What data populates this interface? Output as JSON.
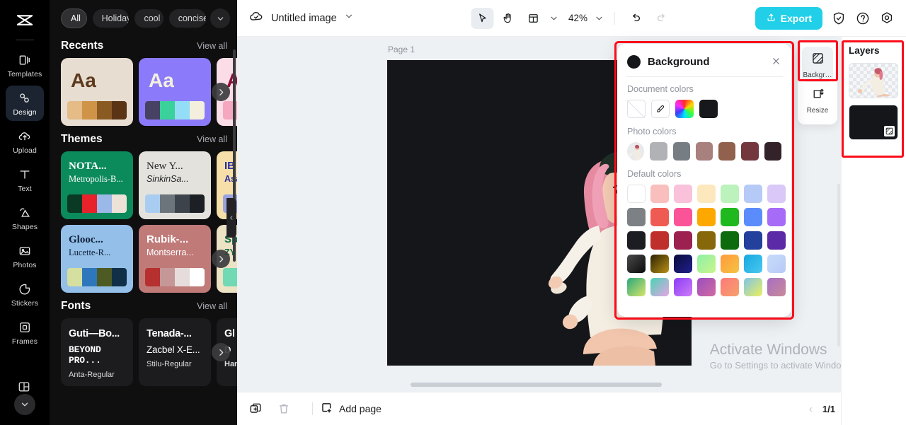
{
  "app": {
    "name": "CapCut",
    "logo_icon": "capcut-logo-icon"
  },
  "rail": {
    "items": [
      {
        "label": "Templates",
        "icon": "templates-icon",
        "active": false
      },
      {
        "label": "Design",
        "icon": "design-icon",
        "active": true
      },
      {
        "label": "Upload",
        "icon": "upload-cloud-icon",
        "active": false
      },
      {
        "label": "Text",
        "icon": "text-icon",
        "active": false
      },
      {
        "label": "Shapes",
        "icon": "shapes-icon",
        "active": false
      },
      {
        "label": "Photos",
        "icon": "photos-icon",
        "active": false
      },
      {
        "label": "Stickers",
        "icon": "stickers-icon",
        "active": false
      },
      {
        "label": "Frames",
        "icon": "frames-icon",
        "active": false
      }
    ],
    "more_icon": "chevron-down-icon",
    "partial_icon": "grid-layout-icon"
  },
  "panel": {
    "chips": [
      {
        "label": "All",
        "active": true
      },
      {
        "label": "Holiday",
        "active": false
      },
      {
        "label": "cool",
        "active": false
      },
      {
        "label": "concise",
        "active": false
      }
    ],
    "chips_more_icon": "chevron-down-icon",
    "sections": [
      {
        "title": "Recents",
        "view_all": "View all",
        "cards": [
          {
            "sample": "Aa",
            "bg": "#e7ddd0",
            "fg": "#5c3a1e",
            "palette": [
              "#e5bb86",
              "#cf9447",
              "#8a5a23",
              "#5a3414"
            ]
          },
          {
            "sample": "Aa",
            "bg": "#8b7bfa",
            "fg": "#f4f0de",
            "palette": [
              "#474264",
              "#3ad19b",
              "#93ddf7",
              "#f3efdc"
            ]
          },
          {
            "sample": "A",
            "bg": "#fadde6",
            "fg": "#8e0e3a",
            "palette": [
              "#f4a7bf",
              "#f7c9d8",
              "#ffffff",
              "#e8718f"
            ]
          }
        ]
      },
      {
        "title": "Themes",
        "view_all": "View all",
        "cards": [
          {
            "title": "NOTA...",
            "subtitle": "Metropolis-B...",
            "bg": "#0b8a5c",
            "fg": "#ffffff",
            "palette": [
              "#0b3a24",
              "#e8222a",
              "#9ab8e8",
              "#ece2d8"
            ]
          },
          {
            "title": "New Y...",
            "subtitle": "SinkinSa...",
            "bg": "#e4e2dc",
            "fg": "#22252a",
            "palette": [
              "#a9cdf0",
              "#6c747c",
              "#3d434b",
              "#1c1f24"
            ]
          },
          {
            "title": "IB",
            "subtitle": "Asa",
            "bg": "#f6dfa8",
            "fg": "#2b2fa0",
            "palette": [
              "#9aa2e0",
              "#c9cdee",
              "#ffffff",
              "#4049b8"
            ]
          },
          {
            "title": "Glooc...",
            "subtitle": "Lucette-R...",
            "bg": "#93bfe8",
            "fg": "#12213a",
            "palette": [
              "#d5dfa0",
              "#2f77bd",
              "#4d5a23",
              "#113048"
            ]
          },
          {
            "title": "Rubik-...",
            "subtitle": "Montserra...",
            "bg": "#c07a78",
            "fg": "#ffffff",
            "palette": [
              "#b5302f",
              "#c59796",
              "#e6dcdb",
              "#ffffff"
            ]
          },
          {
            "title": "Sp",
            "subtitle": "ZY",
            "bg": "#ece2c4",
            "fg": "#0f6b45",
            "palette": [
              "#71d9b4",
              "#bfe9d8",
              "#ffffff",
              "#2fa884"
            ]
          }
        ]
      },
      {
        "title": "Fonts",
        "view_all": "View all",
        "cards": [
          {
            "line1": "Guti—Bo...",
            "line2": "BEYOND PRO...",
            "line3": "Anta-Regular"
          },
          {
            "line1": "Tenada-...",
            "line2": "Zacbel X-E...",
            "line3": "Stilu-Regular"
          },
          {
            "line1": "Gl",
            "line2": "D",
            "line3": "Ham"
          }
        ]
      }
    ],
    "next_arrow_icon": "chevron-right-icon",
    "collapse_icon": "chevron-left-icon"
  },
  "topbar": {
    "cloud_icon": "cloud-saved-icon",
    "doc_title": "Untitled image",
    "title_caret_icon": "chevron-down-icon",
    "tools": [
      {
        "icon": "cursor-select-icon",
        "selected": true
      },
      {
        "icon": "hand-pan-icon",
        "selected": false
      },
      {
        "icon": "layout-grid-icon",
        "selected": false
      }
    ],
    "layout_caret_icon": "chevron-down-icon",
    "zoom_value": "42%",
    "zoom_caret_icon": "chevron-down-icon",
    "undo_icon": "undo-icon",
    "redo_icon": "redo-icon",
    "export_label": "Export",
    "export_icon": "export-upload-icon",
    "export_color": "#21d0e8",
    "shield_icon": "shield-check-icon",
    "help_icon": "question-circle-icon",
    "settings_icon": "gear-icon"
  },
  "canvas": {
    "page_label": "Page 1",
    "artboard_color": "#15161a",
    "watermark_title": "Activate Windows",
    "watermark_sub": "Go to Settings to activate Windows."
  },
  "background_popover": {
    "title": "Background",
    "swatch_color": "#151619",
    "close_icon": "close-icon",
    "highlight_color": "#fc0d1b",
    "groups": [
      {
        "label": "Document colors",
        "swatches": [
          {
            "kind": "none",
            "name": "no-color-swatch"
          },
          {
            "kind": "picker",
            "name": "eyedropper-swatch",
            "icon": "eyedropper-icon"
          },
          {
            "kind": "wheel",
            "name": "color-wheel-swatch"
          },
          {
            "kind": "solid",
            "color": "#17181c"
          }
        ]
      },
      {
        "label": "Photo colors",
        "swatches": [
          {
            "kind": "photo",
            "name": "photo-source-swatch"
          },
          {
            "kind": "solid",
            "color": "#b0b2b5"
          },
          {
            "kind": "solid",
            "color": "#767d83"
          },
          {
            "kind": "solid",
            "color": "#a8807e"
          },
          {
            "kind": "solid",
            "color": "#91614e"
          },
          {
            "kind": "solid",
            "color": "#72383e"
          },
          {
            "kind": "solid",
            "color": "#33222a"
          }
        ]
      },
      {
        "label": "Default colors",
        "grid": [
          [
            "#ffffff",
            "#f8bfbc",
            "#fac1da",
            "#fde8bd",
            "#bcf2bb",
            "#b6caf8",
            "#dac8f8"
          ],
          [
            "#7d8084",
            "#ef5b52",
            "#fb5397",
            "#fca800",
            "#1fb81f",
            "#5b8cfb",
            "#a66cf7"
          ],
          [
            "#1b1d22",
            "#bf2f2c",
            "#9c2151",
            "#86670a",
            "#0c6b0c",
            "#22409c",
            "#5b2aa6"
          ],
          [
            "linear-gradient(135deg,#4a4a4a,#0a0a0a)",
            "linear-gradient(135deg,#2b2205,#b99113)",
            "linear-gradient(135deg,#0c0c3a,#1f1f8f)",
            "linear-gradient(135deg,#8ef0a8,#c9f58b)",
            "linear-gradient(135deg,#ff9a3c,#f6c342)",
            "linear-gradient(135deg,#16a8e0,#49c8f0)",
            "linear-gradient(135deg,#c7dcfb,#b8c9f6)"
          ],
          [
            "linear-gradient(135deg,#2aa87a,#d7e56a)",
            "linear-gradient(135deg,#49d3b3,#e6a5e6)",
            "linear-gradient(135deg,#8a3cf5,#cf7cf7)",
            "linear-gradient(135deg,#9a4ec0,#d26ba0)",
            "linear-gradient(135deg,#fb7a7a,#f7a06a)",
            "linear-gradient(135deg,#7fc4e8,#ecef5e)",
            "linear-gradient(135deg,#a86ec4,#c98a96)"
          ]
        ]
      }
    ]
  },
  "right_tools": {
    "items": [
      {
        "label": "Backgr…",
        "icon": "background-tool-icon",
        "selected": true
      },
      {
        "label": "Resize",
        "icon": "resize-icon",
        "selected": false
      }
    ]
  },
  "layers": {
    "title": "Layers",
    "items": [
      {
        "name": "photo-layer",
        "kind": "photo"
      },
      {
        "name": "background-layer",
        "kind": "solid",
        "color": "#15161a",
        "badge_icon": "background-tool-icon"
      }
    ]
  },
  "bottombar": {
    "duplicate_icon": "duplicate-page-icon",
    "delete_icon": "trash-icon",
    "add_page_label": "Add page",
    "add_page_icon": "add-page-icon",
    "prev_icon": "chevron-left-icon",
    "page_count": "1/1",
    "next_icon": "chevron-right-icon",
    "grid_view_icon": "page-panel-icon"
  }
}
